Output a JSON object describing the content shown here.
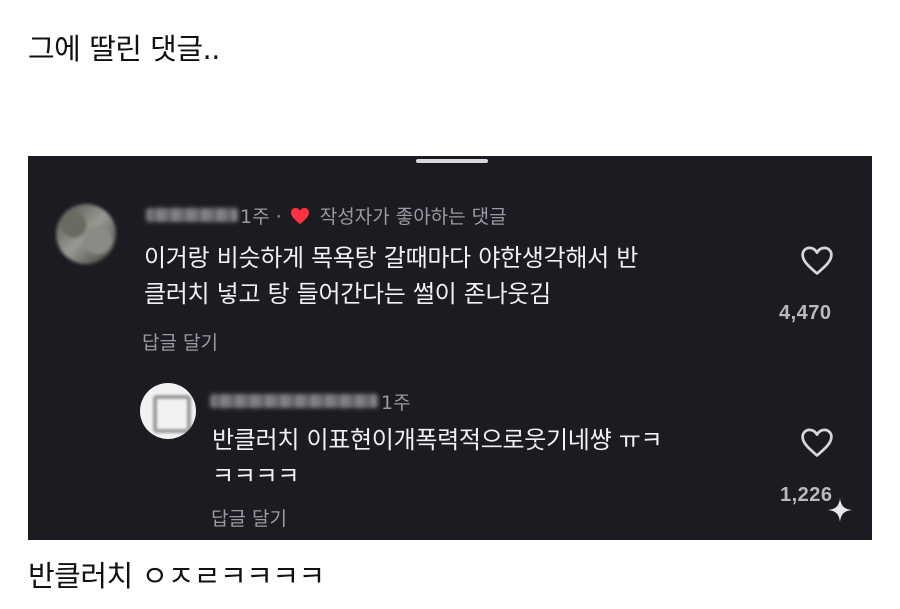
{
  "post": {
    "title": "그에 딸린 댓글..",
    "caption": "반클러치 ㅇㅈㄹㅋㅋㅋㅋ"
  },
  "comments": [
    {
      "time": "1주",
      "separator": "·",
      "creator_like_label": "작성자가 좋아하는 댓글",
      "text_lines": [
        "이거랑 비슷하게 목욕탕 갈때마다 야한생각해서 반",
        "클러치 넣고 탕 들어간다는 썰이 존나웃김"
      ],
      "reply_label": "답글 달기",
      "like_count": "4,470"
    },
    {
      "time": "1주",
      "text_lines": [
        "반클러치 이표현이개폭력적으로웃기네썅 ㅠㅋ",
        "ㅋㅋㅋㅋ"
      ],
      "reply_label": "답글 달기",
      "like_count": "1,226"
    }
  ],
  "colors": {
    "panel_bg": "#1b1c21",
    "heart_red": "#ff3040",
    "text_primary": "#f1f1f3",
    "text_secondary": "#9a9ba2"
  },
  "icons": [
    "heart-filled-icon",
    "heart-outline-icon",
    "sparkle-icon"
  ]
}
